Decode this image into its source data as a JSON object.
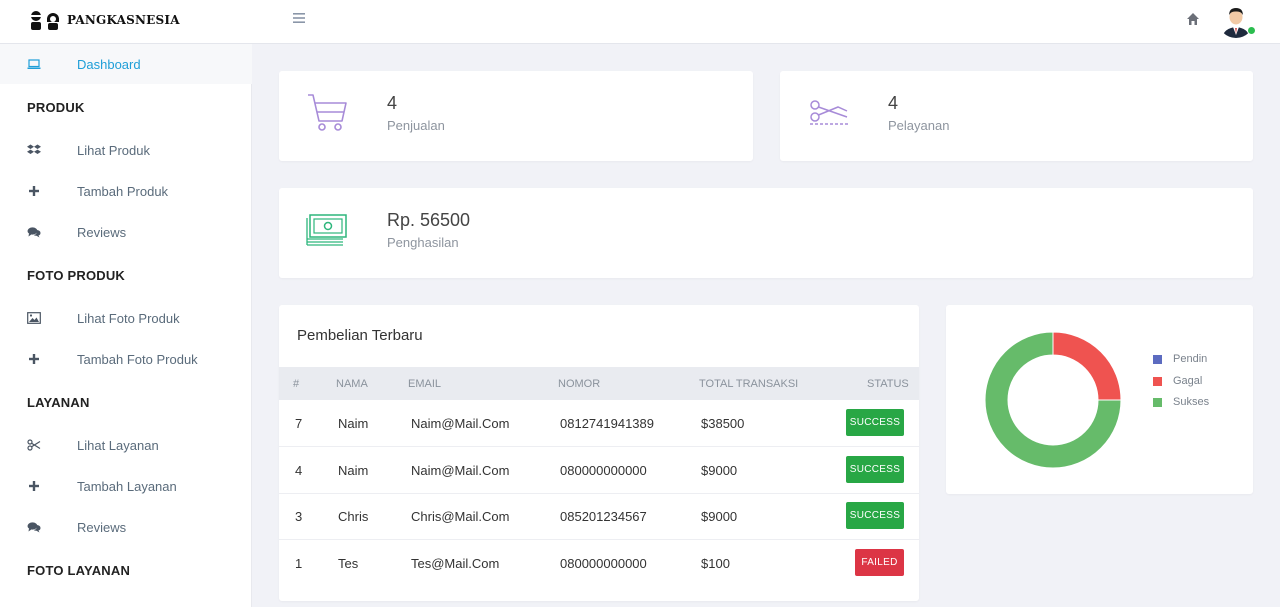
{
  "header": {
    "brand": "PANGKASNESIA"
  },
  "sidebar": {
    "dashboard": "Dashboard",
    "sections": [
      {
        "title": "PRODUK",
        "items": [
          "Lihat Produk",
          "Tambah Produk",
          "Reviews"
        ]
      },
      {
        "title": "FOTO PRODUK",
        "items": [
          "Lihat Foto Produk",
          "Tambah Foto Produk"
        ]
      },
      {
        "title": "LAYANAN",
        "items": [
          "Lihat Layanan",
          "Tambah Layanan",
          "Reviews"
        ]
      },
      {
        "title": "FOTO LAYANAN",
        "items": []
      }
    ]
  },
  "stats": {
    "penjualan": {
      "value": "4",
      "label": "Penjualan"
    },
    "pelayanan": {
      "value": "4",
      "label": "Pelayanan"
    },
    "penghasilan": {
      "value": "Rp. 56500",
      "label": "Penghasilan"
    }
  },
  "table": {
    "title": "Pembelian Terbaru",
    "columns": [
      "#",
      "NAMA",
      "EMAIL",
      "NOMOR",
      "TOTAL TRANSAKSI",
      "STATUS"
    ],
    "rows": [
      {
        "id": "7",
        "nama": "Naim",
        "email": "Naim@Mail.Com",
        "nomor": "0812741941389",
        "total": "$38500",
        "status": "SUCCESS"
      },
      {
        "id": "4",
        "nama": "Naim",
        "email": "Naim@Mail.Com",
        "nomor": "080000000000",
        "total": "$9000",
        "status": "SUCCESS"
      },
      {
        "id": "3",
        "nama": "Chris",
        "email": "Chris@Mail.Com",
        "nomor": "085201234567",
        "total": "$9000",
        "status": "SUCCESS"
      },
      {
        "id": "1",
        "nama": "Tes",
        "email": "Tes@Mail.Com",
        "nomor": "080000000000",
        "total": "$100",
        "status": "FAILED"
      }
    ]
  },
  "colors": {
    "success": "#28a745",
    "failed": "#dc3545",
    "accent": "#1f9fd8",
    "icon_purple": "#a78bd8",
    "icon_green": "#2db67c"
  },
  "chart_data": {
    "type": "pie",
    "categories": [
      "Pendin",
      "Gagal",
      "Sukses"
    ],
    "values": [
      0,
      1,
      3
    ],
    "colors": [
      "#5c6bc0",
      "#ef5350",
      "#66bb6a"
    ],
    "legend": "right"
  }
}
